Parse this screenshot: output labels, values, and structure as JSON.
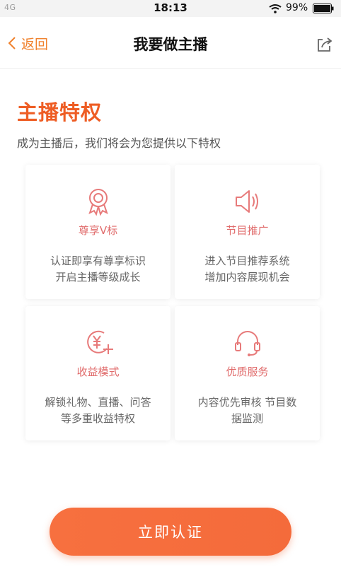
{
  "status_bar": {
    "carrier": "4G",
    "time": "18:13",
    "battery_pct": "99%"
  },
  "nav": {
    "back_label": "返回",
    "title": "我要做主播",
    "share_icon": "share-icon"
  },
  "hero": {
    "title": "主播特权",
    "subtitle": "成为主播后，我们将会为您提供以下特权"
  },
  "privileges": [
    {
      "icon": "badge-icon",
      "title": "尊享V标",
      "desc_line1": "认证即享有尊享标识",
      "desc_line2": "开启主播等级成长"
    },
    {
      "icon": "speaker-icon",
      "title": "节目推广",
      "desc_line1": "进入节目推荐系统",
      "desc_line2": "增加内容展现机会"
    },
    {
      "icon": "yuan-plus-icon",
      "title": "收益模式",
      "desc_line1": "解锁礼物、直播、问答",
      "desc_line2": "等多重收益特权"
    },
    {
      "icon": "headset-icon",
      "title": "优质服务",
      "desc_line1": "内容优先审核 节目数",
      "desc_line2": "据监测"
    }
  ],
  "cta": {
    "label": "立即认证"
  },
  "colors": {
    "accent": "#ee5d24",
    "icon_pink": "#e77a7a",
    "cta": "#f46b3b"
  }
}
